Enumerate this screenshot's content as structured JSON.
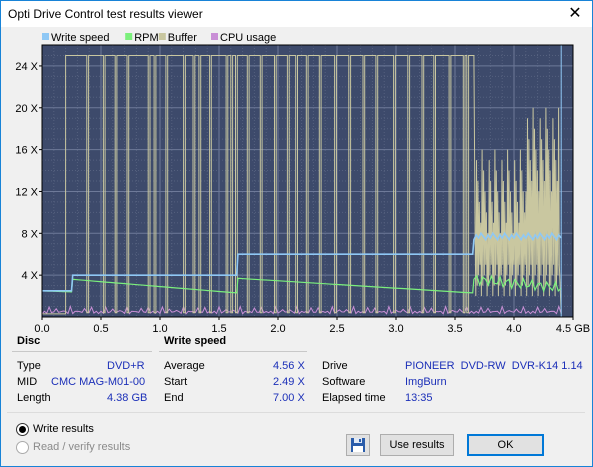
{
  "window": {
    "title": "Opti Drive Control test results viewer",
    "close_glyph": "✕"
  },
  "chart_data": {
    "type": "line",
    "legend": [
      {
        "name": "Write speed",
        "color": "#8fc8f5"
      },
      {
        "name": "RPM",
        "color": "#7cf07c"
      },
      {
        "name": "Buffer",
        "color": "#c9c7a0"
      },
      {
        "name": "CPU usage",
        "color": "#c98fd6"
      }
    ],
    "x_ticks": [
      "0.0",
      "0.5",
      "1.0",
      "1.5",
      "2.0",
      "2.5",
      "3.0",
      "3.5",
      "4.0",
      "4.5 GB"
    ],
    "y_ticks": [
      "4 X",
      "8 X",
      "12 X",
      "16 X",
      "20 X",
      "24 X"
    ],
    "xlim": [
      0,
      4.5
    ],
    "ylim": [
      0,
      26
    ],
    "grid": true,
    "legend_position": "top-left",
    "series": [
      {
        "name": "Write speed",
        "x": [
          0.0,
          0.25,
          0.26,
          1.65,
          1.66,
          3.65,
          3.66,
          4.4
        ],
        "values": [
          2.5,
          2.5,
          4.0,
          4.0,
          6.0,
          6.0,
          7.8,
          7.6
        ]
      },
      {
        "name": "RPM",
        "x": [
          0.0,
          0.25,
          0.26,
          1.65,
          1.66,
          3.65,
          3.66,
          4.4
        ],
        "values": [
          2.5,
          2.4,
          3.6,
          2.3,
          3.7,
          2.3,
          3.6,
          2.8
        ]
      },
      {
        "name": "Buffer",
        "x": [
          0.0,
          0.2,
          0.3,
          0.4,
          3.6,
          3.7,
          4.0,
          4.4
        ],
        "values": [
          24.8,
          25.0,
          25.0,
          25.0,
          25.0,
          8.0,
          12.0,
          10.0
        ]
      },
      {
        "name": "CPU usage",
        "x": [
          0.0,
          1.0,
          2.0,
          3.0,
          4.0,
          4.4
        ],
        "values": [
          0.4,
          0.3,
          0.4,
          0.3,
          0.4,
          0.3
        ]
      }
    ]
  },
  "disc": {
    "header": "Disc",
    "type_label": "Type",
    "type_value": "DVD+R",
    "mid_label": "MID",
    "mid_value": "CMC MAG-M01-00",
    "length_label": "Length",
    "length_value": "4.38 GB"
  },
  "write_speed": {
    "header": "Write speed",
    "average_label": "Average",
    "average_value": "4.56 X",
    "start_label": "Start",
    "start_value": "2.49 X",
    "end_label": "End",
    "end_value": "7.00 X"
  },
  "drive": {
    "drive_label": "Drive",
    "drive_value": "PIONEER  DVD-RW  DVR-K14 1.14",
    "software_label": "Software",
    "software_value": "ImgBurn",
    "elapsed_label": "Elapsed time",
    "elapsed_value": "13:35"
  },
  "options": {
    "write_results": "Write results",
    "read_verify_results": "Read / verify results",
    "selected": "write_results"
  },
  "buttons": {
    "use_results": "Use results",
    "ok": "OK"
  }
}
